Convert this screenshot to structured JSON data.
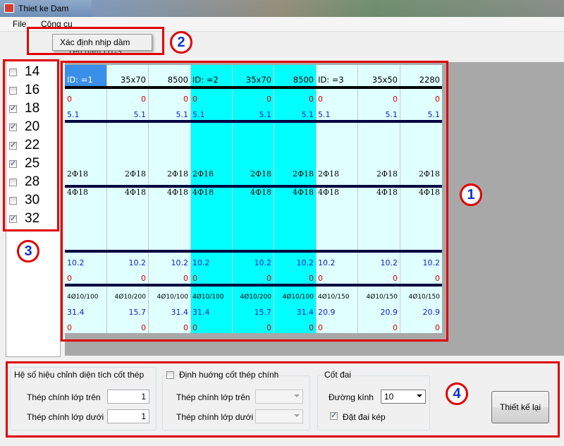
{
  "window": {
    "title": "Thiet ke Dam"
  },
  "menu": {
    "file": "File",
    "tools": "Công cụ",
    "dropdown_item": "Xác định nhịp dầm"
  },
  "ghost_label": "Tên dầm    D1-3",
  "diameters": [
    {
      "label": "14",
      "checked": false
    },
    {
      "label": "16",
      "checked": false
    },
    {
      "label": "18",
      "checked": true
    },
    {
      "label": "20",
      "checked": true
    },
    {
      "label": "22",
      "checked": true
    },
    {
      "label": "25",
      "checked": true
    },
    {
      "label": "28",
      "checked": false
    },
    {
      "label": "30",
      "checked": false
    },
    {
      "label": "32",
      "checked": true
    }
  ],
  "grid": {
    "header": [
      "ID: =1",
      "35x70",
      "8500",
      "ID: =2",
      "35x70",
      "8500",
      "ID: =3",
      "35x50",
      "2280"
    ],
    "rows": [
      {
        "cells": [
          "0",
          "0",
          "0",
          "0",
          "0",
          "0",
          "0",
          "0",
          "0"
        ],
        "style": "red"
      },
      {
        "cells": [
          "5.1",
          "5.1",
          "5.1",
          "5.1",
          "5.1",
          "5.1",
          "5.1",
          "5.1",
          "5.1"
        ],
        "style": "blue"
      },
      {
        "cells": [
          "2Φ18",
          "2Φ18",
          "2Φ18",
          "2Φ18",
          "2Φ18",
          "2Φ18",
          "2Φ18",
          "2Φ18",
          "2Φ18"
        ],
        "style": "serif"
      },
      {
        "cells": [
          "4Φ18",
          "4Φ18",
          "4Φ18",
          "4Φ18",
          "4Φ18",
          "4Φ18",
          "4Φ18",
          "4Φ18",
          "4Φ18"
        ],
        "style": "serif"
      },
      {
        "cells": [
          "10.2",
          "10.2",
          "10.2",
          "10.2",
          "10.2",
          "10.2",
          "10.2",
          "10.2",
          "10.2"
        ],
        "style": "blue"
      },
      {
        "cells": [
          "0",
          "0",
          "0",
          "0",
          "0",
          "0",
          "0",
          "0",
          "0"
        ],
        "style": "red"
      },
      {
        "cells": [
          "4Ø10/100",
          "4Ø10/200",
          "4Ø10/100",
          "4Ø10/100",
          "4Ø10/200",
          "4Ø10/100",
          "4Ø10/150",
          "4Ø10/150",
          "4Ø10/150"
        ],
        "style": "small"
      },
      {
        "cells": [
          "31.4",
          "15.7",
          "31.4",
          "31.4",
          "15.7",
          "31.4",
          "20.9",
          "20.9",
          "20.9"
        ],
        "style": "blue"
      },
      {
        "cells": [
          "0",
          "0",
          "0",
          "0",
          "0",
          "0",
          "0",
          "0",
          "0"
        ],
        "style": "red"
      }
    ]
  },
  "bottom": {
    "coef_group": {
      "title": "Hệ số hiệu chỉnh diện tích cốt thép",
      "top_label": "Thép chính lớp trên",
      "top_value": "1",
      "bottom_label": "Thép chính lớp dưới",
      "bottom_value": "1"
    },
    "orient_group": {
      "title": "Định huớng cốt thép chính",
      "top_label": "Thép chính lớp trên",
      "bottom_label": "Thép chính lớp dưới",
      "checked": false
    },
    "stirrup_group": {
      "title": "Cốt đai",
      "diameter_label": "Đường kính",
      "diameter_value": "10",
      "double_label": "Đặt đai kép",
      "double_checked": true
    },
    "redesign_button": "Thiết kế lại"
  },
  "annotations": [
    "1",
    "2",
    "3",
    "4"
  ],
  "colors": {
    "highlight": "#00ffff",
    "selected": "#3a8fe8",
    "grid_bg": "#e0ffff",
    "annotation": "#e00000"
  }
}
